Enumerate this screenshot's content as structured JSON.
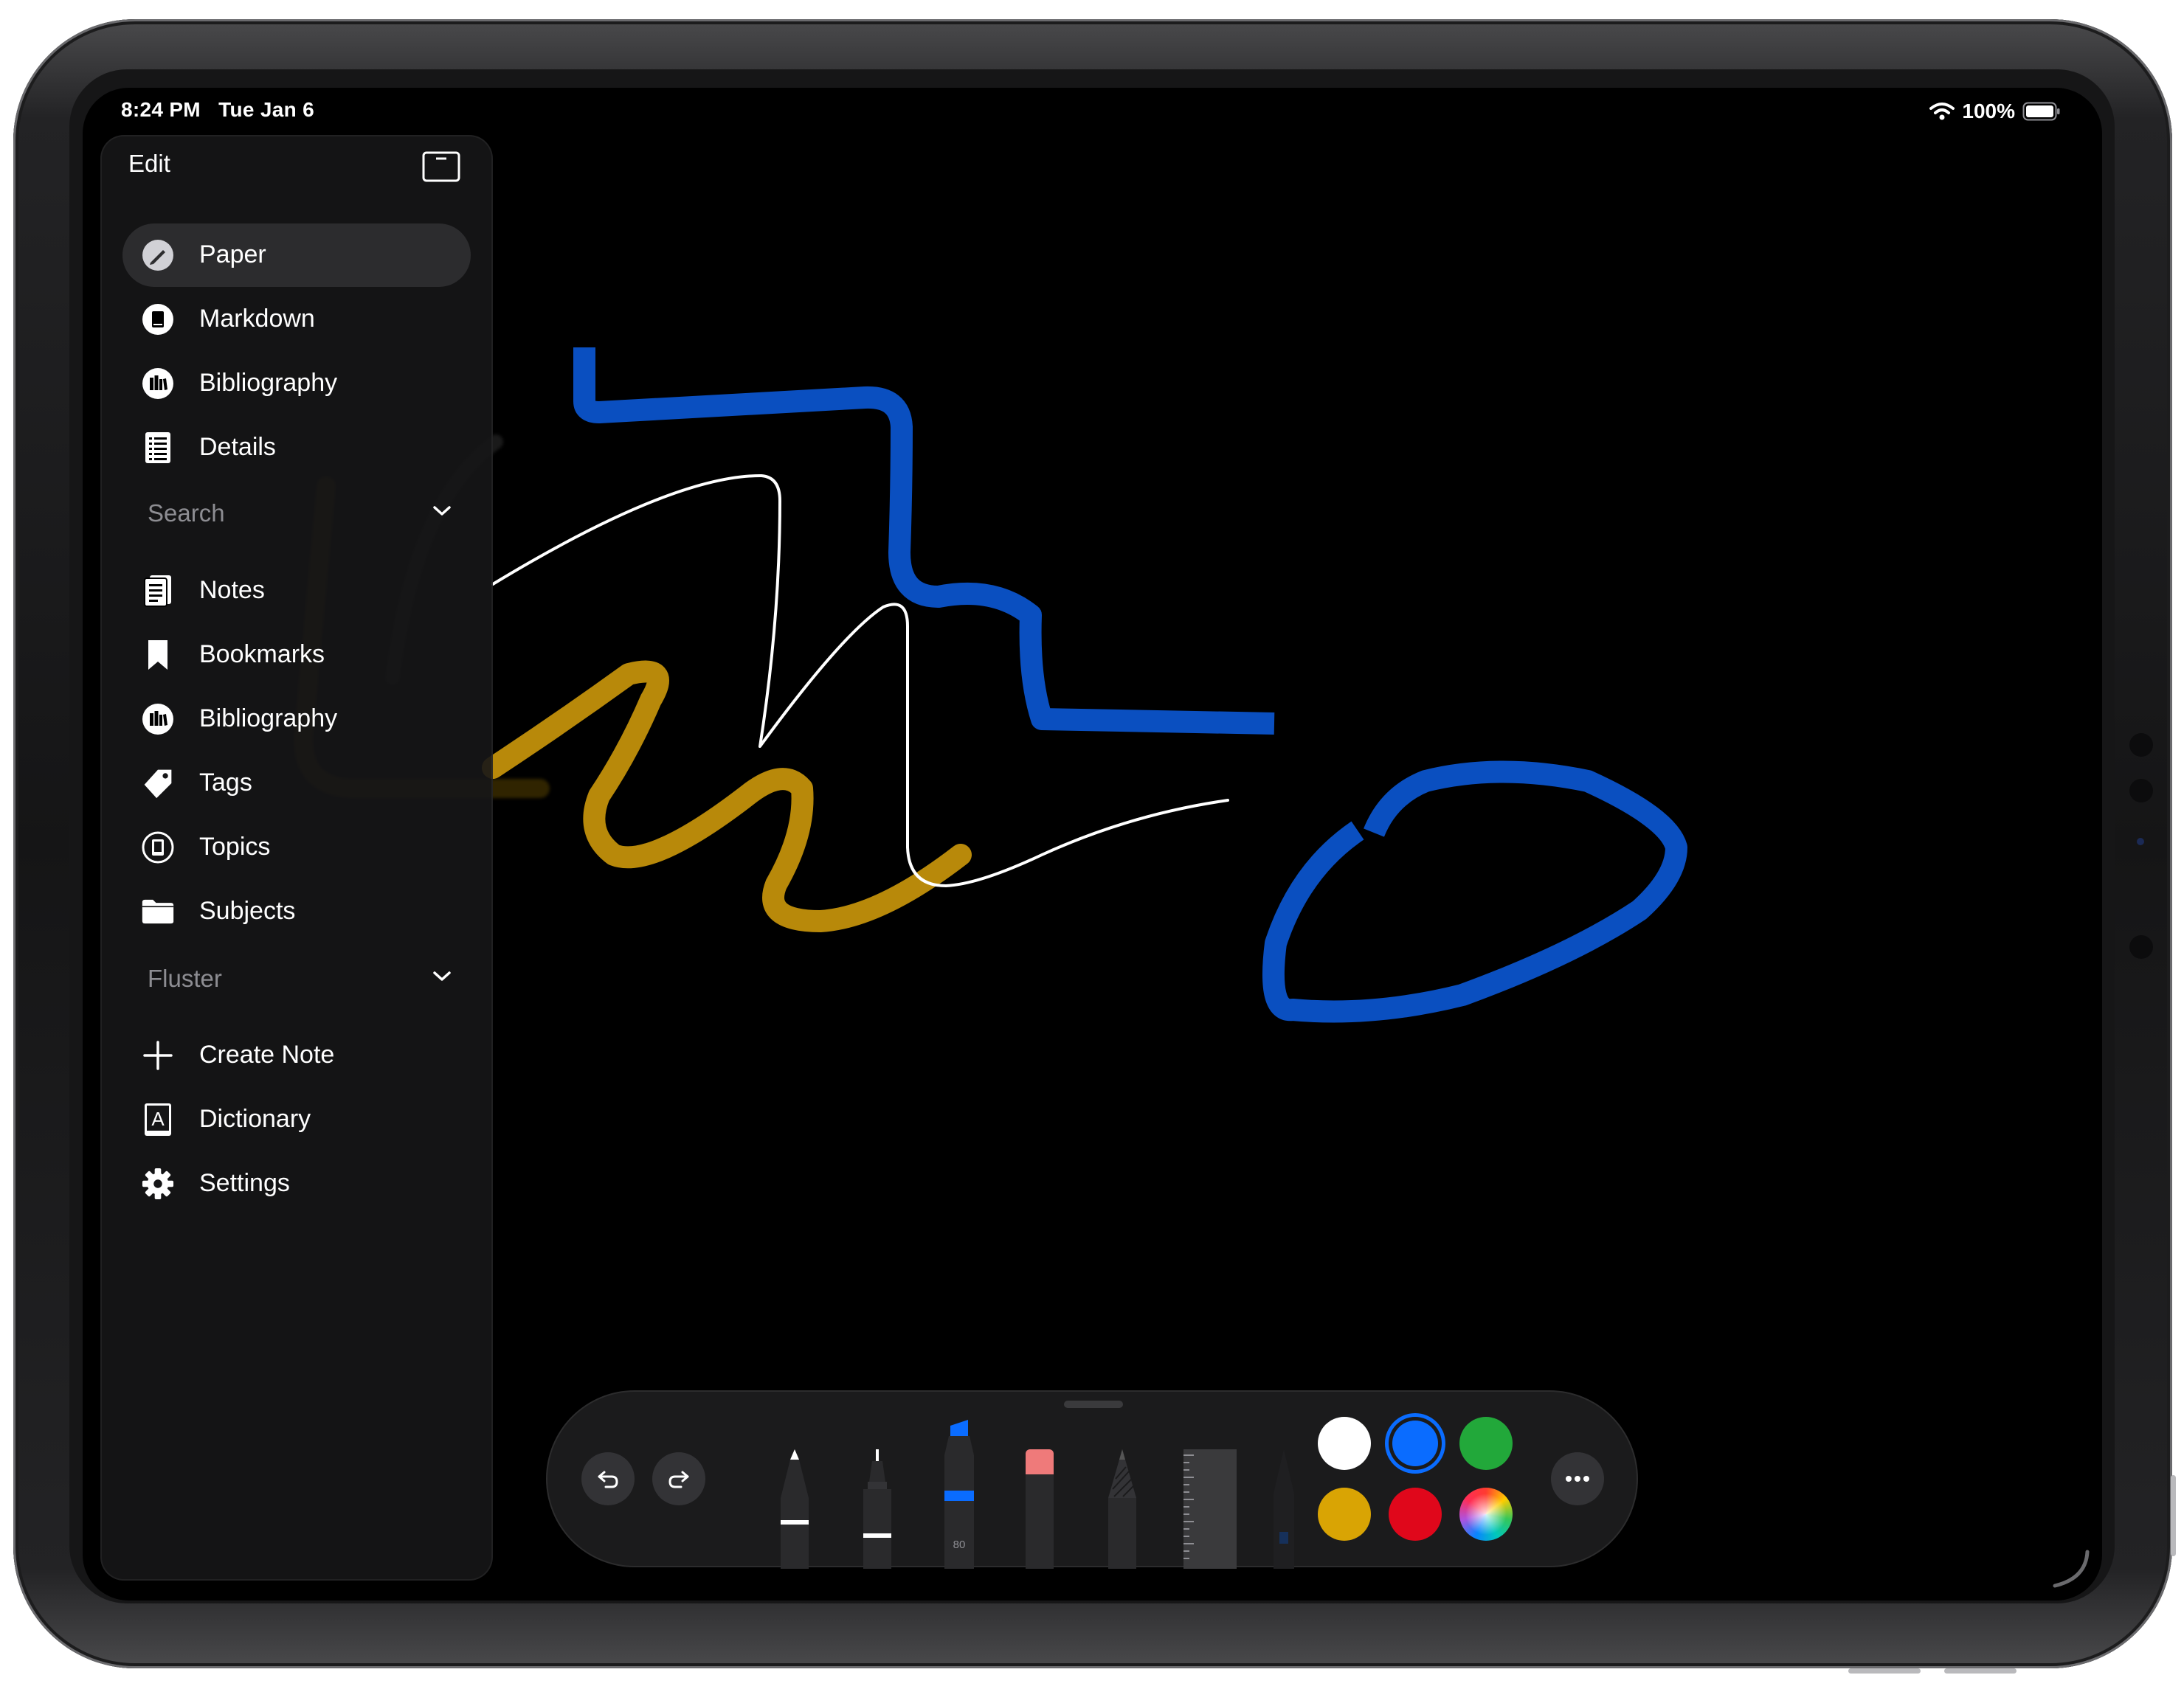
{
  "status_bar": {
    "time": "8:24 PM   Tue Jan 6",
    "battery": "100%"
  },
  "sidebar": {
    "edit_label": "Edit",
    "primary_items": [
      {
        "label": "Paper",
        "icon": "pencil-circle-icon",
        "selected": true
      },
      {
        "label": "Markdown",
        "icon": "document-circle-icon"
      },
      {
        "label": "Bibliography",
        "icon": "books-circle-icon"
      },
      {
        "label": "Details",
        "icon": "list-document-icon"
      }
    ],
    "search_section": {
      "title": "Search",
      "items": [
        {
          "label": "Notes",
          "icon": "notes-icon"
        },
        {
          "label": "Bookmarks",
          "icon": "bookmark-icon"
        },
        {
          "label": "Bibliography",
          "icon": "books-circle-icon"
        },
        {
          "label": "Tags",
          "icon": "tag-icon"
        },
        {
          "label": "Topics",
          "icon": "topics-circle-icon"
        },
        {
          "label": "Subjects",
          "icon": "folder-icon"
        }
      ]
    },
    "fluster_section": {
      "title": "Fluster",
      "items": [
        {
          "label": "Create Note",
          "icon": "plus-icon"
        },
        {
          "label": "Dictionary",
          "icon": "dictionary-icon"
        },
        {
          "label": "Settings",
          "icon": "gear-icon"
        }
      ]
    }
  },
  "toolbar": {
    "tools": [
      "pen",
      "fineliner",
      "marker",
      "eraser",
      "pencil",
      "ruler",
      "lasso"
    ],
    "marker_size_label": "80",
    "colors": [
      {
        "name": "white",
        "hex": "#ffffff"
      },
      {
        "name": "blue",
        "hex": "#0a6cff",
        "selected": true
      },
      {
        "name": "green",
        "hex": "#22a83a"
      },
      {
        "name": "yellow",
        "hex": "#d9a404"
      },
      {
        "name": "red",
        "hex": "#e0071b"
      },
      {
        "name": "color-picker",
        "hex": "conic-gradient"
      }
    ]
  },
  "colors": {
    "ink_blue": "#0a4fc0",
    "ink_yellow": "#b8890a",
    "ink_white": "#ffffff",
    "accent": "#0a6cff"
  }
}
